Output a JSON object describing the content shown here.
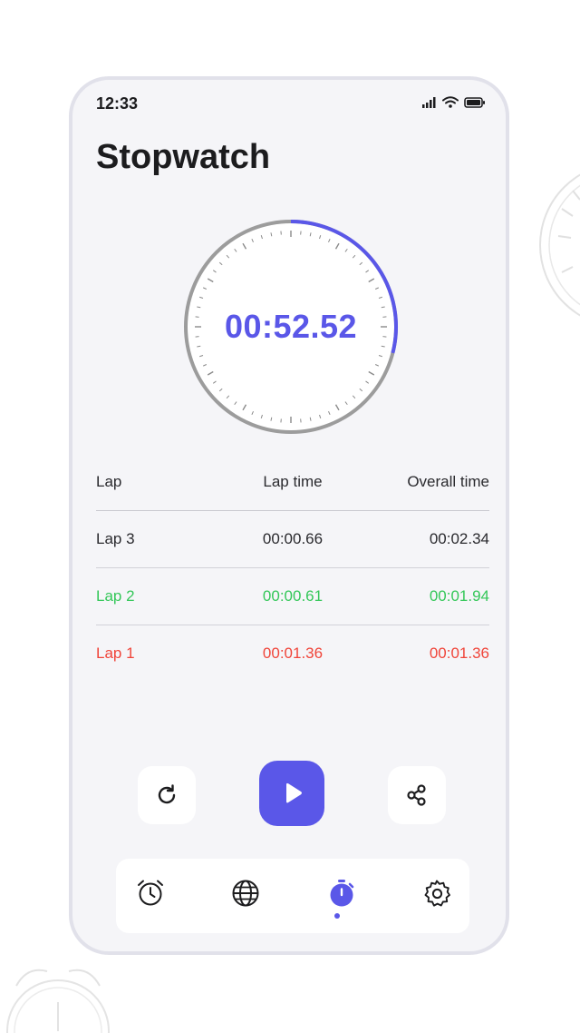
{
  "status_bar": {
    "time": "12:33"
  },
  "page": {
    "title": "Stopwatch"
  },
  "stopwatch": {
    "elapsed": "00:52.52",
    "progress_fraction": 0.29
  },
  "laps": {
    "headers": {
      "lap": "Lap",
      "lap_time": "Lap time",
      "overall": "Overall time"
    },
    "rows": [
      {
        "lap": "Lap 3",
        "lap_time": "00:00.66",
        "overall": "00:02.34",
        "color": "#2a2a2e"
      },
      {
        "lap": "Lap 2",
        "lap_time": "00:00.61",
        "overall": "00:01.94",
        "color": "#34c759"
      },
      {
        "lap": "Lap 1",
        "lap_time": "00:01.36",
        "overall": "00:01.36",
        "color": "#f0453a"
      }
    ]
  },
  "controls": {
    "left": "reset-icon",
    "center": "play-icon",
    "right": "share-icon"
  },
  "tabs": [
    {
      "icon": "alarm-clock-icon",
      "active": false
    },
    {
      "icon": "globe-icon",
      "active": false
    },
    {
      "icon": "stopwatch-icon",
      "active": true
    },
    {
      "icon": "settings-gear-icon",
      "active": false
    }
  ],
  "colors": {
    "accent": "#5a57e8",
    "background": "#f5f5f8",
    "faster": "#34c759",
    "slower": "#f0453a"
  }
}
